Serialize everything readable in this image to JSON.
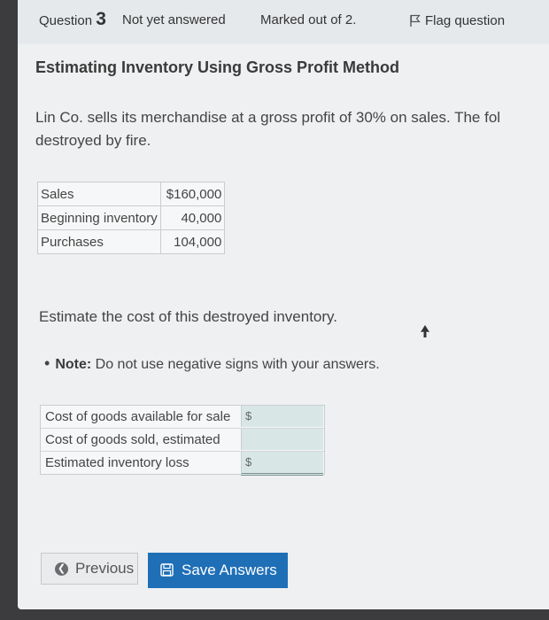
{
  "info": {
    "question_label": "Question",
    "question_number": "3",
    "status": "Not yet answered",
    "marks": "Marked out of 2.",
    "flag_label": "Flag question"
  },
  "title": "Estimating Inventory Using Gross Profit Method",
  "intro": "Lin Co. sells its merchandise at a gross profit of 30% on sales. The fol destroyed by fire.",
  "given_table": [
    {
      "label": "Sales",
      "value": "$160,000"
    },
    {
      "label": "Beginning inventory",
      "value": "40,000"
    },
    {
      "label": "Purchases",
      "value": "104,000"
    }
  ],
  "question": "Estimate the cost of this destroyed inventory.",
  "note": {
    "bold": "Note:",
    "text": " Do not use negative signs with your answers."
  },
  "answer_rows": [
    {
      "label": "Cost of goods available for sale",
      "prefix": "$",
      "value": ""
    },
    {
      "label": "Cost of goods sold, estimated",
      "prefix": "",
      "value": ""
    },
    {
      "label": "Estimated inventory loss",
      "prefix": "$",
      "value": ""
    }
  ],
  "buttons": {
    "previous": "Previous",
    "save": "Save Answers"
  },
  "icons": {
    "flag": "flag-icon",
    "previous": "chevron-left-circle-icon",
    "save": "save-disk-icon"
  },
  "colors": {
    "save_button": "#1f6fb7",
    "input_fill": "#d8e7e6"
  }
}
